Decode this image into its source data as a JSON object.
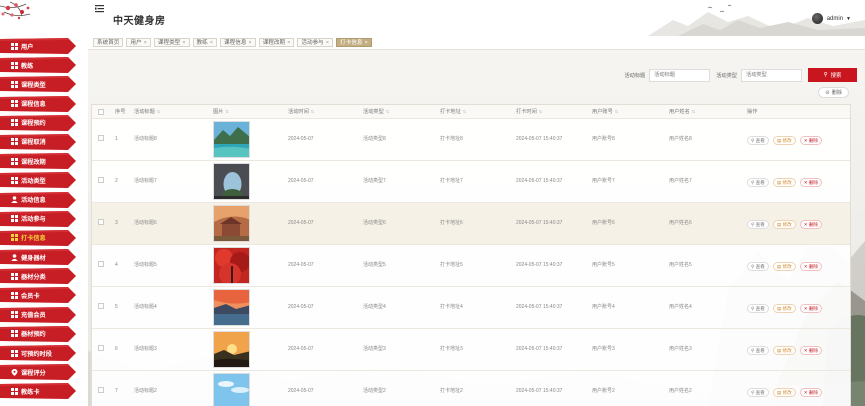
{
  "header": {
    "title": "中天健身房",
    "user": "admin"
  },
  "sidebar": {
    "items": [
      {
        "label": "用户",
        "icon": "grid-icon"
      },
      {
        "label": "教练",
        "icon": "grid-icon"
      },
      {
        "label": "课程类型",
        "icon": "grid-icon"
      },
      {
        "label": "课程信息",
        "icon": "grid-icon"
      },
      {
        "label": "课程预约",
        "icon": "grid-icon"
      },
      {
        "label": "课程取消",
        "icon": "grid-icon"
      },
      {
        "label": "课程改期",
        "icon": "grid-icon"
      },
      {
        "label": "活动类型",
        "icon": "grid-icon"
      },
      {
        "label": "活动信息",
        "icon": "user-icon"
      },
      {
        "label": "活动参与",
        "icon": "grid-icon"
      },
      {
        "label": "打卡信息",
        "icon": "grid-icon"
      },
      {
        "label": "健身器材",
        "icon": "user-icon"
      },
      {
        "label": "器材分类",
        "icon": "grid-icon"
      },
      {
        "label": "会员卡",
        "icon": "grid-icon"
      },
      {
        "label": "充值会员",
        "icon": "grid-icon"
      },
      {
        "label": "器材预约",
        "icon": "grid-icon"
      },
      {
        "label": "可预约时段",
        "icon": "grid-icon"
      },
      {
        "label": "课程评分",
        "icon": "location-icon"
      },
      {
        "label": "教练卡",
        "icon": "grid-icon"
      }
    ],
    "active_index": 10
  },
  "tabs": [
    {
      "label": "系统首页",
      "closable": false
    },
    {
      "label": "用户",
      "closable": true
    },
    {
      "label": "课程类型",
      "closable": true
    },
    {
      "label": "教练",
      "closable": true
    },
    {
      "label": "课程信息",
      "closable": true
    },
    {
      "label": "课程改期",
      "closable": true
    },
    {
      "label": "活动参与",
      "closable": true
    },
    {
      "label": "打卡信息",
      "closable": true,
      "active": true
    }
  ],
  "search": {
    "title_label": "活动标题",
    "title_placeholder": "活动标题",
    "type_label": "活动类型",
    "type_placeholder": "活动类型",
    "button": "搜索"
  },
  "toolbar": {
    "delete": "删除"
  },
  "table": {
    "columns": [
      "序号",
      "活动标题",
      "图片",
      "活动时间",
      "活动类型",
      "打卡地址",
      "打卡时间",
      "用户账号",
      "用户姓名",
      "操作"
    ],
    "actions": {
      "view": "查看",
      "edit": "修改",
      "delete": "删除"
    },
    "rows": [
      {
        "no": "1",
        "title": "活动标题8",
        "time": "2024-05-07",
        "type": "活动类型8",
        "addr": "打卡地址8",
        "checkin": "2024-05-07 15:40:37",
        "account": "用户账号8",
        "name": "用户姓名8",
        "image": "lake"
      },
      {
        "no": "2",
        "title": "活动标题7",
        "time": "2024-05-07",
        "type": "活动类型7",
        "addr": "打卡地址7",
        "checkin": "2024-05-07 15:40:37",
        "account": "用户账号7",
        "name": "用户姓名7",
        "image": "arch"
      },
      {
        "no": "3",
        "title": "活动标题6",
        "time": "2024-05-07",
        "type": "活动类型6",
        "addr": "打卡地址6",
        "checkin": "2024-05-07 15:40:37",
        "account": "用户账号6",
        "name": "用户姓名6",
        "image": "town"
      },
      {
        "no": "4",
        "title": "活动标题5",
        "time": "2024-05-07",
        "type": "活动类型5",
        "addr": "打卡地址5",
        "checkin": "2024-05-07 15:40:37",
        "account": "用户账号5",
        "name": "用户姓名5",
        "image": "autumn"
      },
      {
        "no": "5",
        "title": "活动标题4",
        "time": "2024-05-07",
        "type": "活动类型4",
        "addr": "打卡地址4",
        "checkin": "2024-05-07 15:40:37",
        "account": "用户账号4",
        "name": "用户姓名4",
        "image": "coast"
      },
      {
        "no": "6",
        "title": "活动标题3",
        "time": "2024-05-07",
        "type": "活动类型3",
        "addr": "打卡地址3",
        "checkin": "2024-05-07 15:40:37",
        "account": "用户账号3",
        "name": "用户姓名3",
        "image": "sunset"
      },
      {
        "no": "7",
        "title": "活动标题2",
        "time": "2024-05-07",
        "type": "活动类型2",
        "addr": "打卡地址2",
        "checkin": "2024-05-07 15:40:37",
        "account": "用户账号2",
        "name": "用户姓名2",
        "image": "sky"
      }
    ]
  },
  "colors": {
    "accent": "#c9161e",
    "active_text": "#f4d23b",
    "tab_active": "#c3ad83"
  }
}
